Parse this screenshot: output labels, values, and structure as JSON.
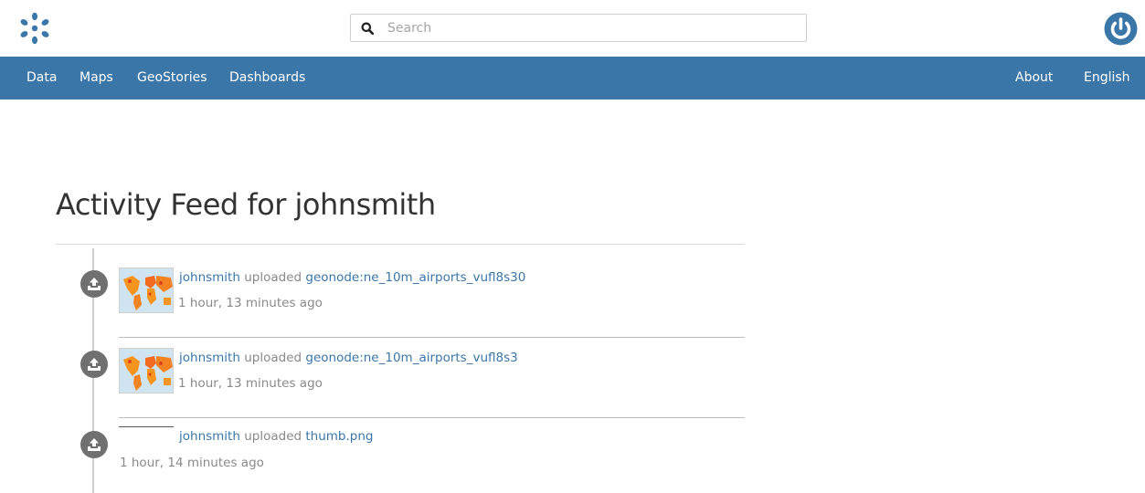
{
  "header": {
    "logo_icon": "geonode-logo-icon",
    "search": {
      "placeholder": "Search",
      "value": ""
    },
    "power_icon": "power-icon",
    "brand_color": "#3a77a8"
  },
  "nav": {
    "left": [
      {
        "label": "Data"
      },
      {
        "label": "Maps"
      },
      {
        "label": "GeoStories"
      },
      {
        "label": "Dashboards"
      }
    ],
    "right": [
      {
        "label": "About"
      },
      {
        "label": "English"
      }
    ]
  },
  "page": {
    "title": "Activity Feed for johnsmith"
  },
  "activities": [
    {
      "actor": "johnsmith",
      "verb": "uploaded",
      "target": "geonode:ne_10m_airports_vufl8s30",
      "time": "1 hour, 13 minutes ago",
      "icon": "upload-icon",
      "thumbnail": "world-map-thumbnail"
    },
    {
      "actor": "johnsmith",
      "verb": "uploaded",
      "target": "geonode:ne_10m_airports_vufl8s3",
      "time": "1 hour, 13 minutes ago",
      "icon": "upload-icon",
      "thumbnail": "world-map-thumbnail"
    },
    {
      "actor": "johnsmith",
      "verb": "uploaded",
      "target": "thumb.png",
      "time": "1 hour, 14 minutes ago",
      "icon": "upload-icon",
      "thumbnail": "broken-thumbnail"
    }
  ]
}
